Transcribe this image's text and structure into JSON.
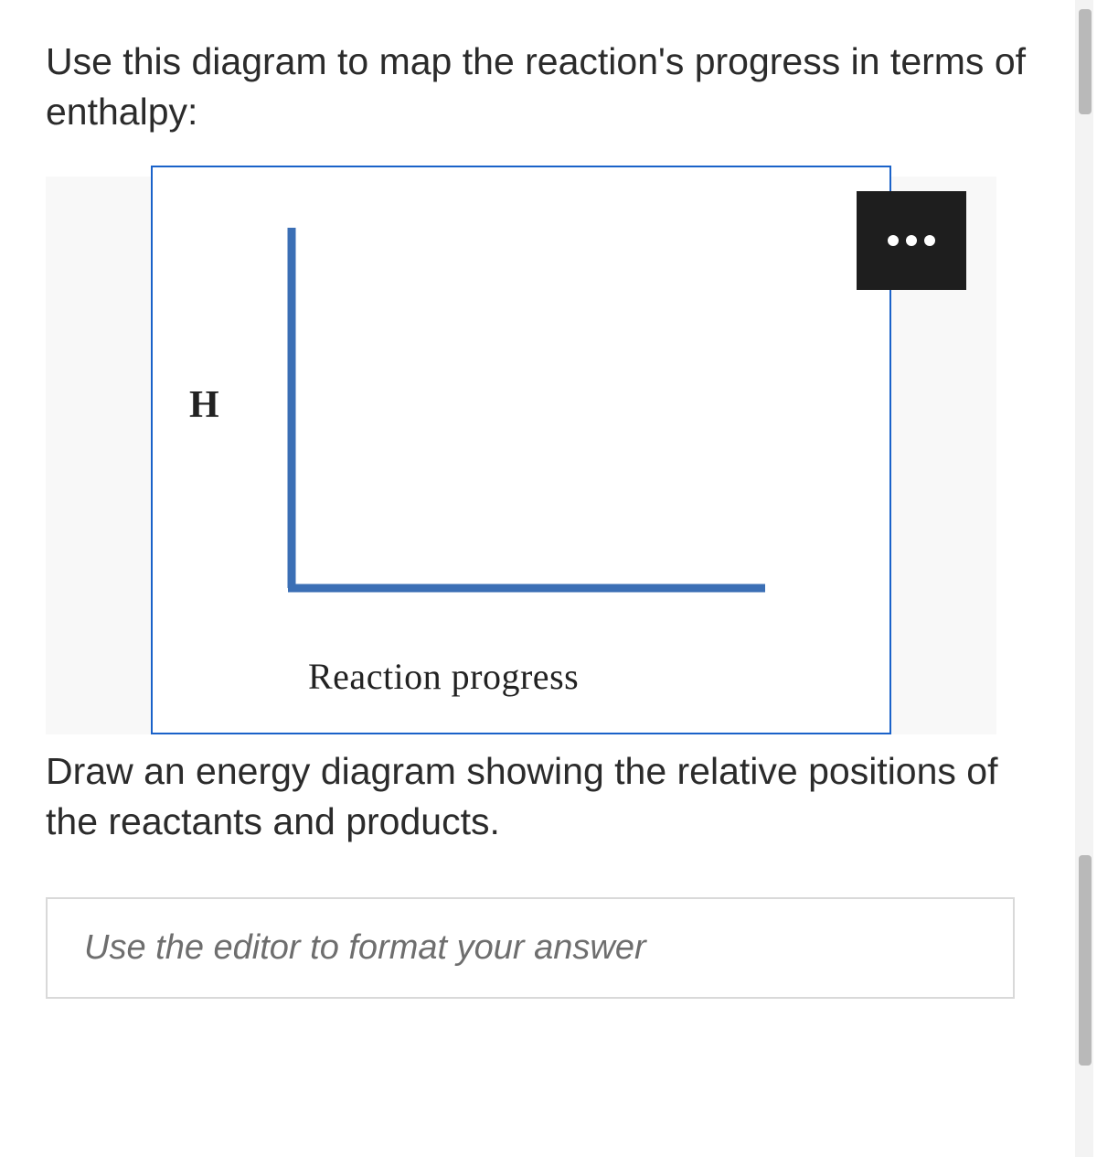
{
  "question": {
    "prompt_line": "Use this diagram to map the reaction's progress in terms of enthalpy:",
    "instruction_line": "Draw an energy diagram showing the relative positions of the reactants and products."
  },
  "diagram": {
    "y_axis_label": "H",
    "x_axis_label": "Reaction progress"
  },
  "editor": {
    "placeholder": "Use the editor to format your answer"
  },
  "chart_data": {
    "type": "line",
    "title": "",
    "xlabel": "Reaction progress",
    "ylabel": "H",
    "series": [],
    "x": [],
    "annotations": [
      "Blank enthalpy vs. reaction-progress axes (no data plotted)"
    ]
  }
}
